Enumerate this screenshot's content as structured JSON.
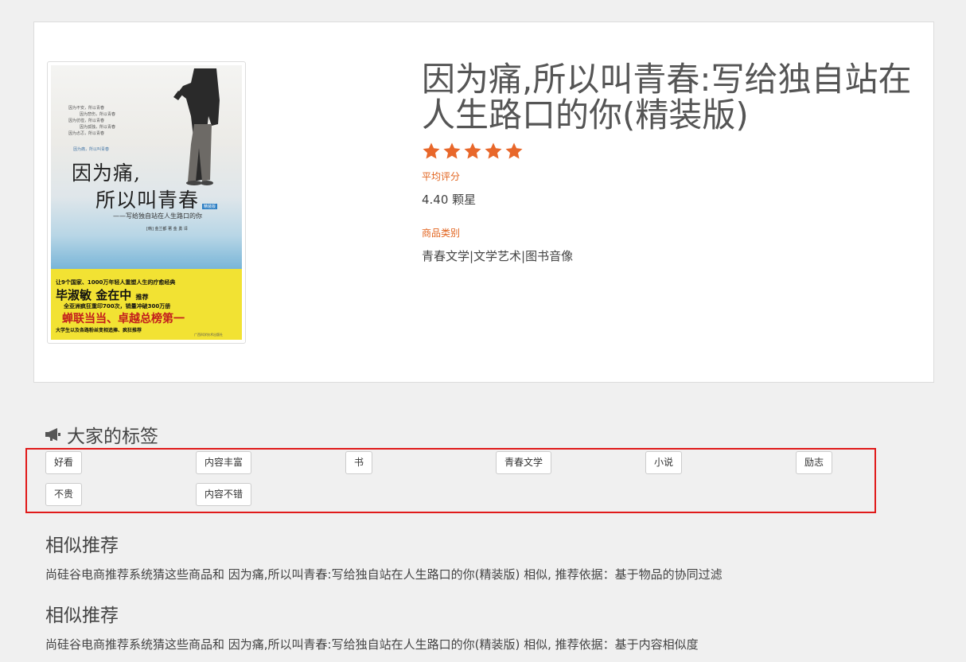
{
  "product": {
    "title": "因为痛,所以叫青春:写给独自站在人生路口的你(精装版)",
    "star_count": 5,
    "star_color": "#e8672a",
    "rating_label": "平均评分",
    "rating_value": "4.40 颗星",
    "category_label": "商品类别",
    "category_value": "青春文学|文学艺术|图书音像",
    "cover": {
      "poem_lines": [
        "因为不安，所以青春",
        "因为悲伤，所以青春",
        "因为彷徨，所以青春",
        "因为孤独，所以青春",
        "因为忐忑，所以青春"
      ],
      "tiny_text": "因为痛，所以叫青春",
      "title_line1": "因为痛,",
      "title_line2": "所以叫青春",
      "edition": "精装版",
      "subtitle": "——写给独自站在人生路口的你",
      "authors": "[韩] 金兰都 著   金 勇 译",
      "band_line1": "让9个国家、1000万年轻人重塑人生的疗愈经典",
      "band_line2": "毕淑敏 金在中",
      "band_line2_suffix": "推荐",
      "band_line3": "全亚洲疯狂重印700次，销量冲破300万册",
      "band_line4": "蝉联当当、卓越总榜第一",
      "band_line5": "大学生以及各路粉丝变相追捧、疯狂推荐",
      "publisher": "广西科学技术出版社"
    }
  },
  "tags": {
    "title": "大家的标签",
    "icon": "bullhorn-icon",
    "items": [
      "好看",
      "内容丰富",
      "书",
      "青春文学",
      "小说",
      "励志",
      "不贵",
      "内容不错"
    ],
    "highlight_color": "#e01a1a"
  },
  "recommendations": [
    {
      "title": "相似推荐",
      "description": "尚硅谷电商推荐系统猜这些商品和 因为痛,所以叫青春:写给独自站在人生路口的你(精装版) 相似, 推荐依据：基于物品的协同过滤"
    },
    {
      "title": "相似推荐",
      "description": "尚硅谷电商推荐系统猜这些商品和 因为痛,所以叫青春:写给独自站在人生路口的你(精装版) 相似, 推荐依据：基于内容相似度"
    }
  ]
}
